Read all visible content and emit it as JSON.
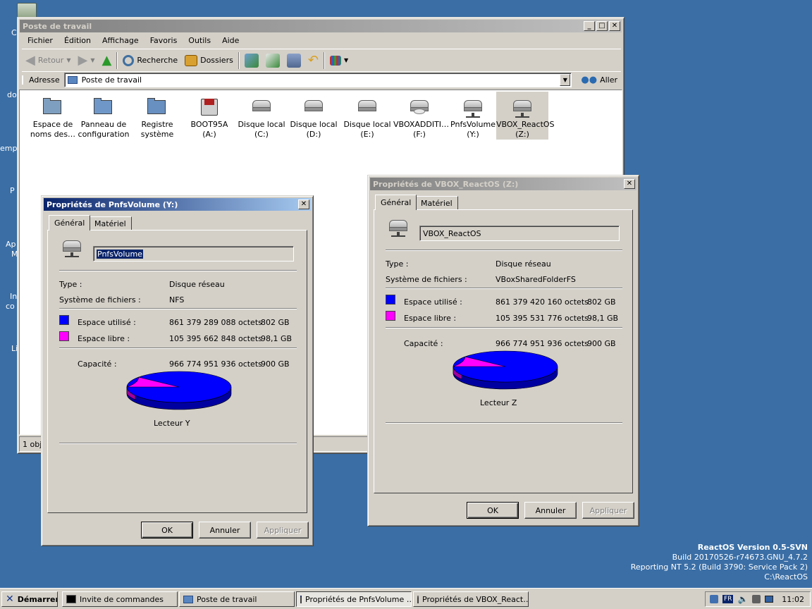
{
  "explorer": {
    "title": "Poste de travail",
    "menu": [
      "Fichier",
      "Édition",
      "Affichage",
      "Favoris",
      "Outils",
      "Aide"
    ],
    "toolbar": {
      "back": "Retour",
      "search": "Recherche",
      "folders": "Dossiers"
    },
    "address_label": "Adresse",
    "address_value": "Poste de travail",
    "go_label": "Aller",
    "status": "1 obje",
    "items": [
      {
        "line1": "Espace de",
        "line2": "noms des…",
        "icon": "namespace-folder-icon"
      },
      {
        "line1": "Panneau de",
        "line2": "configuration",
        "icon": "control-panel-icon"
      },
      {
        "line1": "Registre",
        "line2": "système",
        "icon": "registry-icon"
      },
      {
        "line1": "BOOT95A",
        "line2": "(A:)",
        "icon": "floppy-drive-icon"
      },
      {
        "line1": "Disque local",
        "line2": "(C:)",
        "icon": "hard-drive-icon"
      },
      {
        "line1": "Disque local",
        "line2": "(D:)",
        "icon": "hard-drive-icon"
      },
      {
        "line1": "Disque local",
        "line2": "(E:)",
        "icon": "hard-drive-icon"
      },
      {
        "line1": "VBOXADDITI…",
        "line2": "(F:)",
        "icon": "cdrom-drive-icon"
      },
      {
        "line1": "PnfsVolume",
        "line2": "(Y:)",
        "icon": "network-drive-icon"
      },
      {
        "line1": "VBOX_ReactOS",
        "line2": "(Z:)",
        "icon": "network-drive-icon"
      }
    ]
  },
  "dlg1": {
    "title": "Propriétés de PnfsVolume (Y:)",
    "tabs": [
      "Général",
      "Matériel"
    ],
    "name": "PnfsVolume",
    "type_label": "Type :",
    "type_value": "Disque réseau",
    "fs_label": "Système de fichiers :",
    "fs_value": "NFS",
    "used_label": "Espace utilisé :",
    "used_bytes": "861 379 289 088 octets",
    "used_h": "802 GB",
    "free_label": "Espace libre :",
    "free_bytes": "105 395 662 848 octets",
    "free_h": "98,1 GB",
    "cap_label": "Capacité :",
    "cap_bytes": "966 774 951 936 octets",
    "cap_h": "900 GB",
    "drive_label": "Lecteur Y",
    "used_fraction": 0.891,
    "buttons": {
      "ok": "OK",
      "cancel": "Annuler",
      "apply": "Appliquer"
    }
  },
  "dlg2": {
    "title": "Propriétés de VBOX_ReactOS (Z:)",
    "tabs": [
      "Général",
      "Matériel"
    ],
    "name": "VBOX_ReactOS",
    "type_label": "Type :",
    "type_value": "Disque réseau",
    "fs_label": "Système de fichiers :",
    "fs_value": "VBoxSharedFolderFS",
    "used_label": "Espace utilisé :",
    "used_bytes": "861 379 420 160 octets",
    "used_h": "802 GB",
    "free_label": "Espace libre :",
    "free_bytes": "105 395 531 776 octets",
    "free_h": "98,1 GB",
    "cap_label": "Capacité :",
    "cap_bytes": "966 774 951 936 octets",
    "cap_h": "900 GB",
    "drive_label": "Lecteur Z",
    "used_fraction": 0.891,
    "buttons": {
      "ok": "OK",
      "cancel": "Annuler",
      "apply": "Appliquer"
    }
  },
  "colors": {
    "used": "#0000ff",
    "free": "#ff00ff"
  },
  "version": {
    "line1": "ReactOS Version 0.5-SVN",
    "line2": "Build 20170526-r74673.GNU_4.7.2",
    "line3": "Reporting NT 5.2 (Build 3790: Service Pack 2)",
    "line4": "C:\\ReactOS"
  },
  "taskbar": {
    "start": "Démarrer",
    "items": [
      "Invite de commandes",
      "Poste de travail",
      "Propriétés de PnfsVolume …",
      "Propriétés de VBOX_React…"
    ],
    "lang": "FR",
    "clock": "11:02"
  },
  "desktop_labels": [
    "C",
    "do",
    "emp",
    "P",
    "Ap",
    "M",
    "In",
    "co",
    "Li"
  ]
}
